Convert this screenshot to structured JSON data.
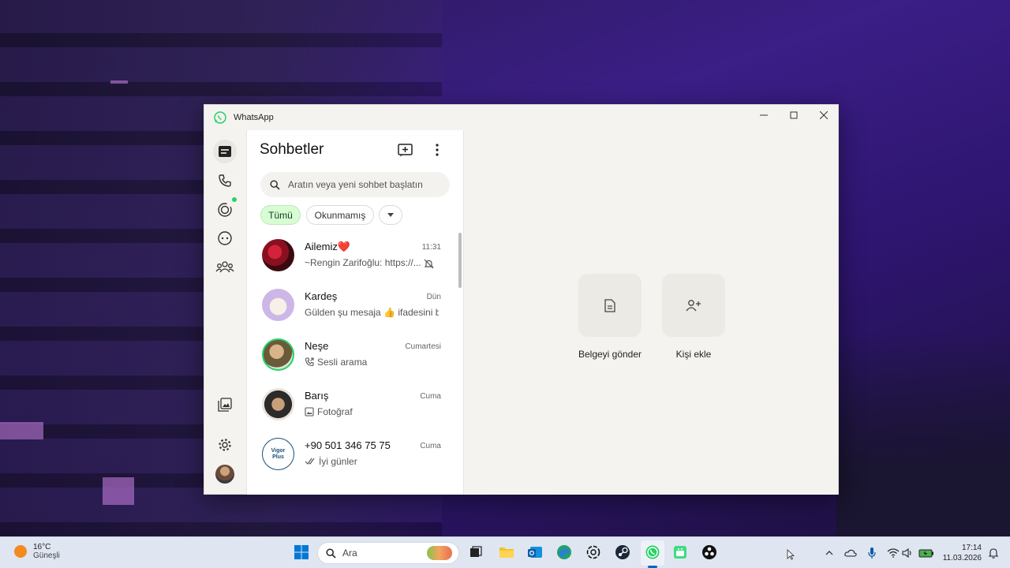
{
  "window": {
    "title": "WhatsApp"
  },
  "chats_panel": {
    "title": "Sohbetler",
    "search_placeholder": "Aratın veya yeni sohbet başlatın",
    "filters": [
      "Tümü",
      "Okunmamış"
    ],
    "items": [
      {
        "name": "Ailemiz❤️",
        "time": "11:31",
        "message": "~Rengin Zarifoğlu: https://...",
        "icon": "mute-icon"
      },
      {
        "name": "Kardeş",
        "time": "Dün",
        "message": "Gülden şu mesaja 👍 ifadesini b",
        "icon": ""
      },
      {
        "name": "Neşe",
        "time": "Cumartesi",
        "message": "Sesli arama",
        "icon": "call-icon"
      },
      {
        "name": "Barış",
        "time": "Cuma",
        "message": "Fotoğraf",
        "icon": "photo-icon"
      },
      {
        "name": "+90 501 346 75 75",
        "time": "Cuma",
        "message": "İyi günler",
        "icon": "double-check-icon"
      }
    ]
  },
  "avatar_texts": {
    "vigor": "Vigor Plus"
  },
  "main_pane": {
    "actions": [
      {
        "label": "Belgeyi gönder",
        "icon": "document-icon"
      },
      {
        "label": "Kişi ekle",
        "icon": "add-contact-icon"
      }
    ]
  },
  "taskbar": {
    "weather_temp": "16°C",
    "weather_condition": "Güneşli",
    "search_label": "Ara",
    "time": "17:14",
    "date": "11.03.2026"
  },
  "colors": {
    "accent": "#25d366",
    "chip_active": "#d9fdd3"
  }
}
